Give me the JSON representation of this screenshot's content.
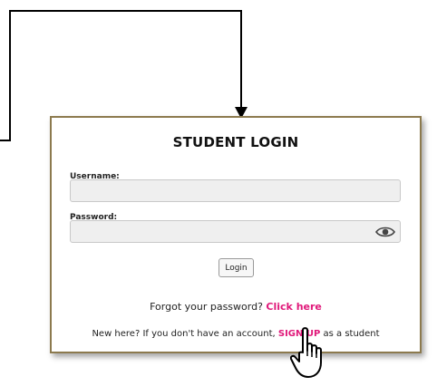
{
  "login": {
    "title": "STUDENT LOGIN",
    "username_label": "Username:",
    "username_value": "",
    "password_label": "Password:",
    "password_value": "",
    "login_button": "Login",
    "forgot_text": "Forgot your password?",
    "forgot_link": "Click here",
    "signup_prefix": "New here? If you don't have an account,",
    "signup_link": "SIGN UP",
    "signup_suffix": "as a student"
  },
  "icons": {
    "password_toggle": "eye-icon",
    "cursor": "hand-pointer-icon"
  },
  "colors": {
    "card_border": "#8c7a4e",
    "link": "#e0197a",
    "input_bg": "#efefef",
    "connector": "#000000"
  }
}
